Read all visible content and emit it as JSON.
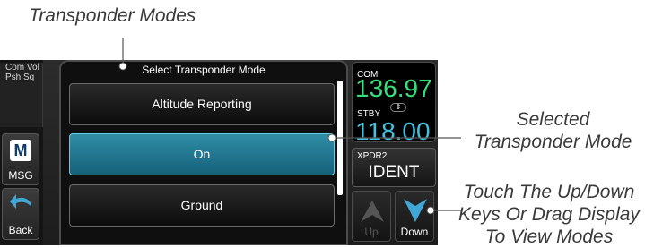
{
  "callouts": {
    "title": "Transponder Modes",
    "selected_line1": "Selected",
    "selected_line2": "Transponder Mode",
    "touch_line1": "Touch The Up/Down",
    "touch_line2": "Keys Or Drag Display",
    "touch_line3": "To View Modes"
  },
  "left_keys": {
    "com_vol_line1": "Com Vol",
    "com_vol_line2": "Psh Sq",
    "msg_icon": "M",
    "msg_label": "MSG",
    "back_label": "Back"
  },
  "panel": {
    "title": "Select Transponder Mode",
    "modes": [
      "Altitude Reporting",
      "On",
      "Ground"
    ],
    "selected_index": 1
  },
  "radio": {
    "com_label": "COM",
    "com_freq": "136.97",
    "stby_label": "STBY",
    "stby_freq": "118.00",
    "xpdr_label": "XPDR2",
    "xpdr_value": "IDENT",
    "up_label": "Up",
    "down_label": "Down"
  },
  "colors": {
    "active_freq": "#33e07a",
    "standby_freq": "#3fc3e0",
    "selected_button": "#1f7a93"
  }
}
